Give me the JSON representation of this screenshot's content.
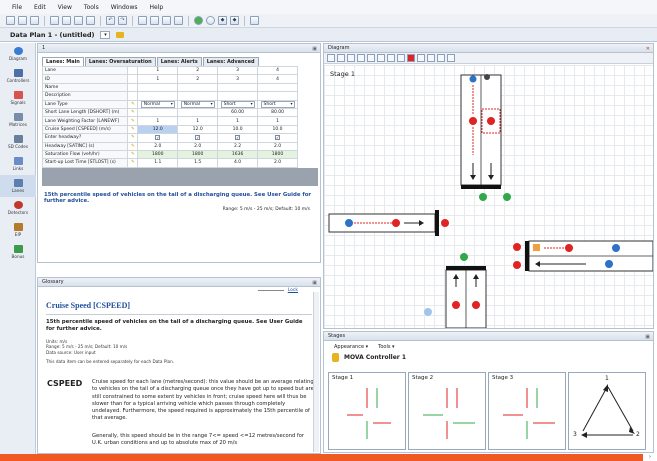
{
  "menu": [
    "File",
    "Edit",
    "View",
    "Tools",
    "Windows",
    "Help"
  ],
  "toolbar_icons": [
    "new-icon",
    "open-icon",
    "save-icon",
    "copy-icon",
    "paste-icon",
    "print-icon",
    "print-preview-icon",
    "undo-icon",
    "redo-icon",
    "run-icon",
    "report-icon",
    "table-icon",
    "chart-icon",
    "help-icon",
    "back-icon",
    "forward-icon",
    "refresh-icon",
    "settings-icon"
  ],
  "plan": {
    "title": "Data Plan 1 - (untitled)"
  },
  "nav": [
    {
      "label": "Diagram",
      "color": "#3a7bd5"
    },
    {
      "label": "Controllers",
      "color": "#4d6fa8"
    },
    {
      "label": "Signals",
      "color": "#d9534f"
    },
    {
      "label": "Matrices",
      "color": "#7a8da8"
    },
    {
      "label": "SD Codes",
      "color": "#6b7f9d"
    },
    {
      "label": "Links",
      "color": "#6a8cc7"
    },
    {
      "label": "Lanes",
      "color": "#5a7fb0"
    },
    {
      "label": "Detectors",
      "color": "#c0392b"
    },
    {
      "label": "EIP",
      "color": "#b47b2a"
    },
    {
      "label": "Bonus",
      "color": "#3c9a48"
    }
  ],
  "lanes_panel": {
    "title": "1",
    "tabs": [
      "Lanes: Main",
      "Lanes: Oversaturation",
      "Lanes: Alerts",
      "Lanes: Advanced"
    ],
    "columns": [
      "1",
      "2",
      "3",
      "4"
    ],
    "rows": [
      {
        "label": "Lane",
        "values": [
          "1",
          "2",
          "3",
          "4"
        ]
      },
      {
        "label": "ID",
        "values": [
          "1",
          "2",
          "3",
          "4"
        ]
      },
      {
        "label": "Name",
        "values": [
          "",
          "",
          "",
          ""
        ]
      },
      {
        "label": "Description",
        "values": [
          "",
          "",
          "",
          ""
        ]
      },
      {
        "label": "Lane Type",
        "values": [
          "Normal",
          "Normal",
          "Short",
          "Short"
        ]
      },
      {
        "label": "Short Lane Length [DSHORT] (m)",
        "values": [
          "",
          "",
          "60.00",
          "80.00"
        ]
      },
      {
        "label": "Lane Weighting Factor [LANEWF]",
        "values": [
          "1",
          "1",
          "1",
          "1"
        ]
      },
      {
        "label": "Cruise Speed [CSPEED] (m/s)",
        "values": [
          "12.0",
          "12.0",
          "10.0",
          "10.0"
        ]
      },
      {
        "label": "Enter headway?",
        "values": [
          "✓",
          "✓",
          "✓",
          "✓"
        ]
      },
      {
        "label": "Headway [SATINC] (s)",
        "values": [
          "2.0",
          "2.0",
          "2.2",
          "2.0"
        ]
      },
      {
        "label": "Saturation Flow (veh/hr)",
        "values": [
          "1800",
          "1800",
          "1636",
          "1800"
        ]
      },
      {
        "label": "Start-up Lost Time [STLOST] (s)",
        "values": [
          "1.1",
          "1.5",
          "4.0",
          "2.0"
        ]
      }
    ],
    "hint": "15th percentile speed of vehicles on the tail of a discharging queue. See User Guide for further advice.",
    "range": "Range: 5 m/s - 25 m/s; Default: 10 m/s"
  },
  "glossary": {
    "header": "Glossary",
    "link": "Lock",
    "title": "Cruise Speed [CSPEED]",
    "subtitle": "15th percentile speed of vehicles on the tail of a discharging queue. See User Guide for further advice.",
    "units": "Units: m/s",
    "range": "Range: 5 m/s - 25 m/s; Default: 10 m/s",
    "source": "Data source: User input",
    "note": "This data item can be entered separately for each Data Plan.",
    "term": "CSPEED",
    "desc": "Cruise speed for each lane (metres/second): this value should be an average relating to vehicles on the tail of a discharging queue once they have got up to speed but are still constrained to some extent by vehicles in front; cruise speed here will thus be slower than for a typical arriving vehicle which passes through completely undelayed. Furthermore, the speed required is approximately the 15th percentile of that average.",
    "desc2": "Generally, this speed should be in the range 7<= speed <=12 metres/second for U.K. urban conditions and up to absolute max of 20 m/s"
  },
  "diagram": {
    "header": "Diagram",
    "stage_label": "Stage 1",
    "tool_icons": [
      "select-icon",
      "zoom-in-icon",
      "zoom-out-icon",
      "pan-icon",
      "move-icon",
      "rotate-icon",
      "grid-icon",
      "snap-icon",
      "node-icon",
      "arrow-icon",
      "link-icon",
      "text-icon",
      "lock-icon"
    ]
  },
  "stages_panel": {
    "header": "Stages",
    "menu": [
      "Appearance ▾",
      "Tools ▾"
    ],
    "controller": "MOVA Controller 1",
    "stages": [
      "Stage 1",
      "Stage 2",
      "Stage 3"
    ],
    "sequence": [
      "1",
      "2",
      "3"
    ]
  },
  "colors": {
    "accent": "#1f4e9c",
    "bottom_bar": "#f05a22",
    "signal_red": "#e02424",
    "signal_green": "#31a84a",
    "node_blue": "#2c73c8"
  }
}
